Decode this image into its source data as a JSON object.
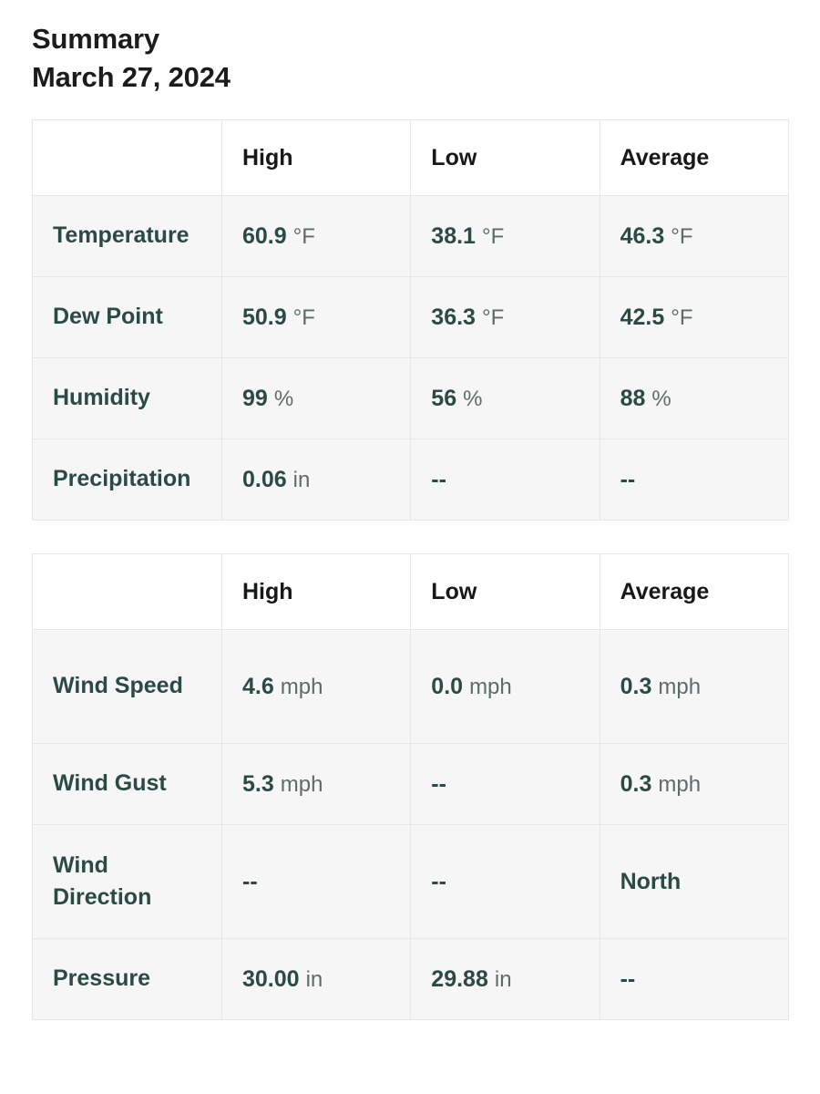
{
  "header": {
    "title": "Summary",
    "date": "March 27, 2024"
  },
  "columns": {
    "blank": "",
    "high": "High",
    "low": "Low",
    "average": "Average"
  },
  "colors": {
    "value_teal": "#2c4a44",
    "unit_gray": "#5d6c69",
    "header_black": "#16181a",
    "cell_bg": "#f5f6f5",
    "header_bg": "#ffffff",
    "border": "#e6e7e6"
  },
  "no_data": "--",
  "tables": [
    {
      "name": "conditions-table",
      "headers": [
        "",
        "High",
        "Low",
        "Average"
      ],
      "rows": [
        {
          "label": "Temperature",
          "high": {
            "value": "60.9",
            "unit": "°F"
          },
          "low": {
            "value": "38.1",
            "unit": "°F"
          },
          "average": {
            "value": "46.3",
            "unit": "°F"
          }
        },
        {
          "label": "Dew Point",
          "high": {
            "value": "50.9",
            "unit": "°F"
          },
          "low": {
            "value": "36.3",
            "unit": "°F"
          },
          "average": {
            "value": "42.5",
            "unit": "°F"
          }
        },
        {
          "label": "Humidity",
          "high": {
            "value": "99",
            "unit": "%"
          },
          "low": {
            "value": "56",
            "unit": "%"
          },
          "average": {
            "value": "88",
            "unit": "%"
          }
        },
        {
          "label": "Precipitation",
          "high": {
            "value": "0.06",
            "unit": "in"
          },
          "low": {
            "value": "--",
            "unit": ""
          },
          "average": {
            "value": "--",
            "unit": ""
          }
        }
      ]
    },
    {
      "name": "wind-table",
      "headers": [
        "",
        "High",
        "Low",
        "Average"
      ],
      "rows": [
        {
          "label": "Wind Speed",
          "high": {
            "value": "4.6",
            "unit": "mph"
          },
          "low": {
            "value": "0.0",
            "unit": "mph"
          },
          "average": {
            "value": "0.3",
            "unit": "mph"
          }
        },
        {
          "label": "Wind Gust",
          "high": {
            "value": "5.3",
            "unit": "mph"
          },
          "low": {
            "value": "--",
            "unit": ""
          },
          "average": {
            "value": "0.3",
            "unit": "mph"
          }
        },
        {
          "label": "Wind Direction",
          "high": {
            "value": "--",
            "unit": ""
          },
          "low": {
            "value": "--",
            "unit": ""
          },
          "average": {
            "value": "North",
            "unit": ""
          }
        },
        {
          "label": "Pressure",
          "high": {
            "value": "30.00",
            "unit": "in"
          },
          "low": {
            "value": "29.88",
            "unit": "in"
          },
          "average": {
            "value": "--",
            "unit": ""
          }
        }
      ]
    }
  ]
}
